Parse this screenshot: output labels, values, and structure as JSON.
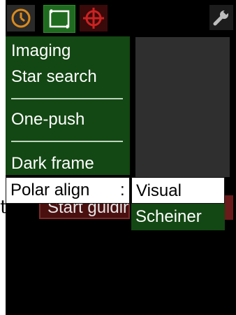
{
  "toolbar": {
    "tabs": [
      {
        "name": "clock-tab",
        "icon": "clock-icon"
      },
      {
        "name": "frame-tab",
        "icon": "frame-icon"
      },
      {
        "name": "target-tab",
        "icon": "crosshair-icon"
      }
    ],
    "settings_icon": "wrench-icon"
  },
  "menu": {
    "items": [
      "Imaging",
      "Star search",
      "One-push",
      "Dark frame"
    ],
    "polar_align": {
      "label": "Polar align",
      "separator": ":"
    }
  },
  "submenu": {
    "options": [
      "Visual",
      "Scheiner"
    ],
    "selected": "Visual"
  },
  "background": {
    "start_button_label": "Start guiding",
    "stray_text": "t"
  },
  "colors": {
    "menu_bg": "#134713",
    "selected_bg": "#ffffff",
    "accent_clock": "#d98a1e",
    "accent_target": "#cc2222"
  }
}
